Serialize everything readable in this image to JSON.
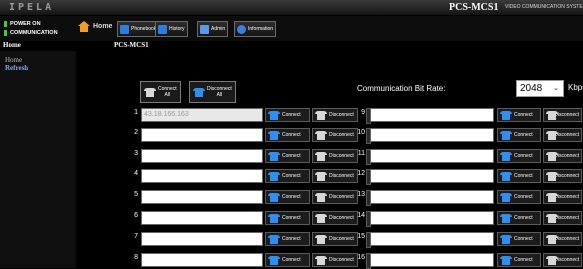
{
  "header": {
    "logo": "IPELA",
    "model": "PCS-MCS1",
    "subtitle": "VIDEO COMMUNICATION SYSTE"
  },
  "power": {
    "line1": "POWER ON",
    "line2": "COMMUNICATION"
  },
  "nav": {
    "home": "Home",
    "phonebook": "Phonebook",
    "history": "History",
    "admin": "Admin",
    "information": "Information"
  },
  "breadcrumb": {
    "left": "Home",
    "right": "PCS-MCS1"
  },
  "sidebar": {
    "items": [
      "Home",
      "Refresh"
    ]
  },
  "toolbar": {
    "connect_all": [
      "Connect",
      "All"
    ],
    "disconnect_all": [
      "Disconnect",
      "All"
    ]
  },
  "bitrate": {
    "label": "Communication Bit Rate:",
    "value": "2048",
    "unit": "Kbps"
  },
  "sites_left": [
    {
      "num": "1",
      "value": "43.18.166.163",
      "connect": "Connect",
      "disconnect": "Disconnect"
    },
    {
      "num": "2",
      "value": "",
      "connect": "Connect",
      "disconnect": "Disconnect"
    },
    {
      "num": "3",
      "value": "",
      "connect": "Connect",
      "disconnect": "Disconnect"
    },
    {
      "num": "4",
      "value": "",
      "connect": "Connect",
      "disconnect": "Disconnect"
    },
    {
      "num": "5",
      "value": "",
      "connect": "Connect",
      "disconnect": "Disconnect"
    },
    {
      "num": "6",
      "value": "",
      "connect": "Connect",
      "disconnect": "Disconnect"
    },
    {
      "num": "7",
      "value": "",
      "connect": "Connect",
      "disconnect": "Disconnect"
    },
    {
      "num": "8",
      "value": "",
      "connect": "Connect",
      "disconnect": "Disconnect"
    }
  ],
  "sites_right": [
    {
      "num": "9",
      "value": "",
      "connect": "Connect",
      "disconnect": "Disconnect"
    },
    {
      "num": "10",
      "value": "",
      "connect": "Connect",
      "disconnect": "Disconnect"
    },
    {
      "num": "11",
      "value": "",
      "connect": "Connect",
      "disconnect": "Disconnect"
    },
    {
      "num": "12",
      "value": "",
      "connect": "Connect",
      "disconnect": "Disconnect"
    },
    {
      "num": "13",
      "value": "",
      "connect": "Connect",
      "disconnect": "Disconnect"
    },
    {
      "num": "14",
      "value": "",
      "connect": "Connect",
      "disconnect": "Disconnect"
    },
    {
      "num": "15",
      "value": "",
      "connect": "Connect",
      "disconnect": "Disconnect"
    },
    {
      "num": "16",
      "value": "",
      "connect": "Connect",
      "disconnect": "Disconnect"
    }
  ]
}
